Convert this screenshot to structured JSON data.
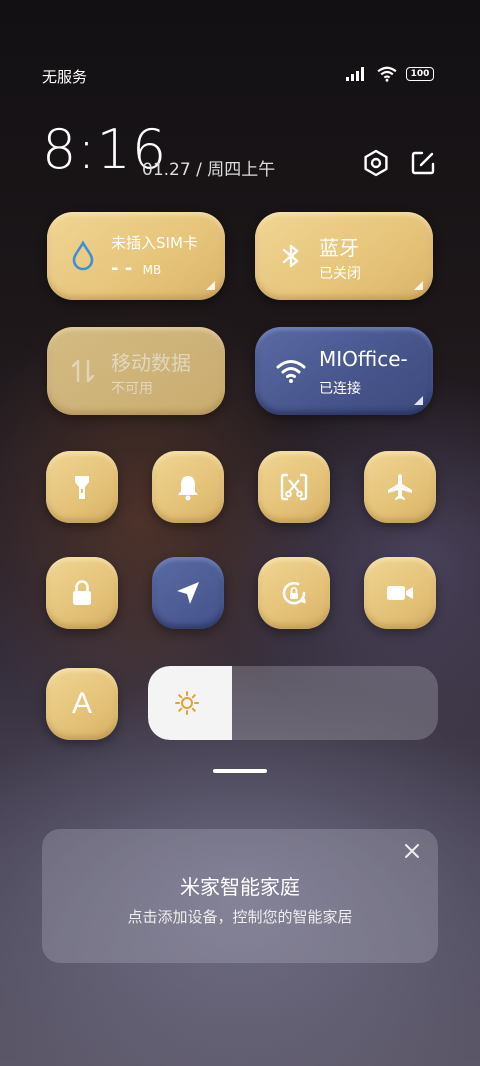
{
  "status_bar": {
    "carrier": "无服务",
    "battery": "100"
  },
  "header": {
    "time": "8:16",
    "date": "01.27 / 周四上午"
  },
  "big_tiles": [
    {
      "title": "未插入SIM卡",
      "value": "- -",
      "unit": "MB"
    },
    {
      "title": "蓝牙",
      "sub": "已关闭"
    },
    {
      "title": "移动数据",
      "sub": "不可用"
    },
    {
      "title": "MIOffice-",
      "sub": "已连接"
    }
  ],
  "small_tiles": {
    "flashlight": "flashlight-icon",
    "bell": "bell-icon",
    "screenshot": "screenshot-icon",
    "airplane": "airplane-icon",
    "lock": "lock-icon",
    "location": "location-icon",
    "rotation_lock": "rotation-lock-icon",
    "video": "video-camera-icon",
    "font": "A"
  },
  "brightness": {
    "level": 0.29
  },
  "home_card": {
    "title": "米家智能家庭",
    "subtitle": "点击添加设备，控制您的智能家居"
  },
  "colors": {
    "tile_gold": "#e6c47a",
    "tile_blue": "#46548b",
    "icon_blue": "#4a90d9"
  }
}
